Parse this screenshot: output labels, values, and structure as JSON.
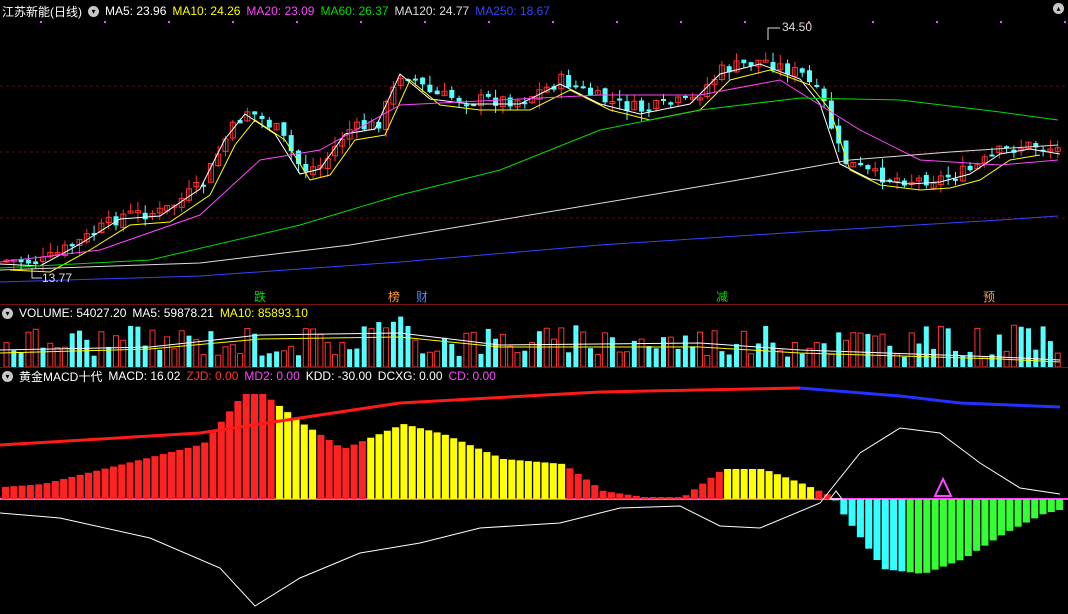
{
  "main": {
    "title": "江苏新能(日线)",
    "ma": [
      {
        "label": "MA5: 23.96",
        "color": "#ffffff"
      },
      {
        "label": "MA10: 24.26",
        "color": "#ffff00"
      },
      {
        "label": "MA20: 23.09",
        "color": "#ff44ff"
      },
      {
        "label": "MA60: 26.37",
        "color": "#00dd00"
      },
      {
        "label": "MA120: 24.77",
        "color": "#dddddd"
      },
      {
        "label": "MA250: 18.67",
        "color": "#3344ff"
      }
    ],
    "high_label": "34.50",
    "low_label": "13.77",
    "markers": [
      "跌",
      "榜",
      "财",
      "减",
      "预"
    ]
  },
  "volume": {
    "label": "VOLUME: 54027.20",
    "ma5": "MA5: 59878.21",
    "ma10": "MA10: 85893.10"
  },
  "macd": {
    "title": "黄金MACD十代",
    "items": [
      {
        "label": "MACD: 16.02",
        "color": "#ffffff"
      },
      {
        "label": "ZJD: 0.00",
        "color": "#ff3333"
      },
      {
        "label": "MD2: 0.00",
        "color": "#ff44ff"
      },
      {
        "label": "KDD: -30.00",
        "color": "#ffffff"
      },
      {
        "label": "DCXG: 0.00",
        "color": "#ffffff"
      },
      {
        "label": "CD: 0.00",
        "color": "#ff44ff"
      }
    ]
  },
  "colors": {
    "up": "#ff3232",
    "down": "#54ffff",
    "bg": "#000000",
    "grid": "#7a1010"
  }
}
